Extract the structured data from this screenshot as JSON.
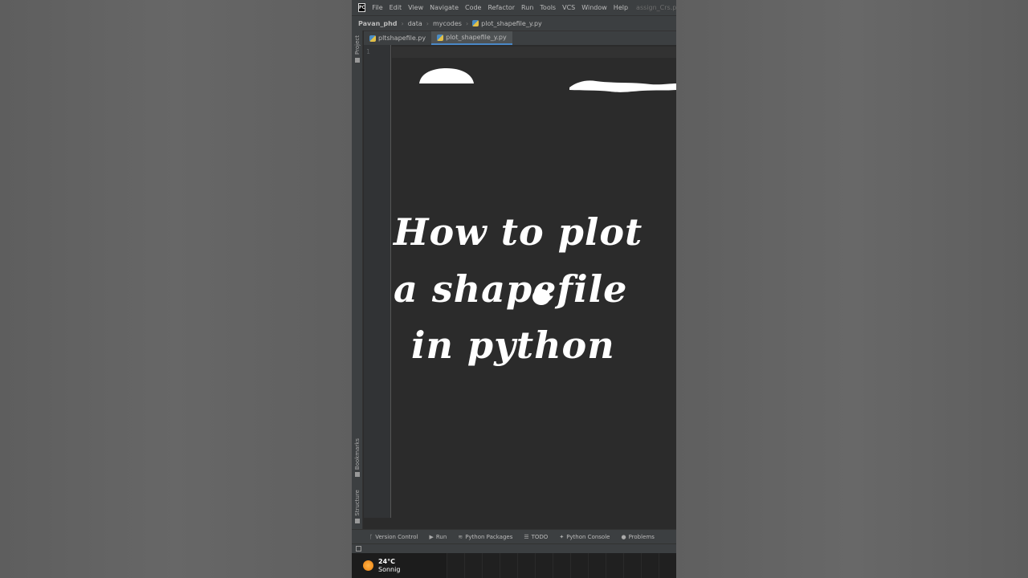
{
  "menubar": {
    "items": [
      "File",
      "Edit",
      "View",
      "Navigate",
      "Code",
      "Refactor",
      "Run",
      "Tools",
      "VCS",
      "Window",
      "Help"
    ],
    "window_title": "assign_Crs.py - p"
  },
  "breadcrumb": {
    "project": "Pavan_phd",
    "folder1": "data",
    "folder2": "mycodes",
    "file": "plot_shapefile_y.py"
  },
  "tabs": [
    {
      "label": "pltshapefile.py",
      "active": false
    },
    {
      "label": "plot_shapefile_y.py",
      "active": true
    }
  ],
  "left_strip": {
    "project": "Project",
    "bookmarks": "Bookmarks",
    "structure": "Structure"
  },
  "editor": {
    "line_numbers": [
      "1"
    ]
  },
  "overlay": {
    "line1": "How to plot",
    "line2": "a shapefile",
    "line3": "in python"
  },
  "bottom_tools": [
    {
      "label": "Version Control",
      "icon": "branch-icon"
    },
    {
      "label": "Run",
      "icon": "play-icon"
    },
    {
      "label": "Python Packages",
      "icon": "layers-icon"
    },
    {
      "label": "TODO",
      "icon": "list-icon"
    },
    {
      "label": "Python Console",
      "icon": "python-icon"
    },
    {
      "label": "Problems",
      "icon": "info-icon"
    }
  ],
  "taskbar": {
    "temperature": "24°C",
    "condition": "Sonnig"
  }
}
